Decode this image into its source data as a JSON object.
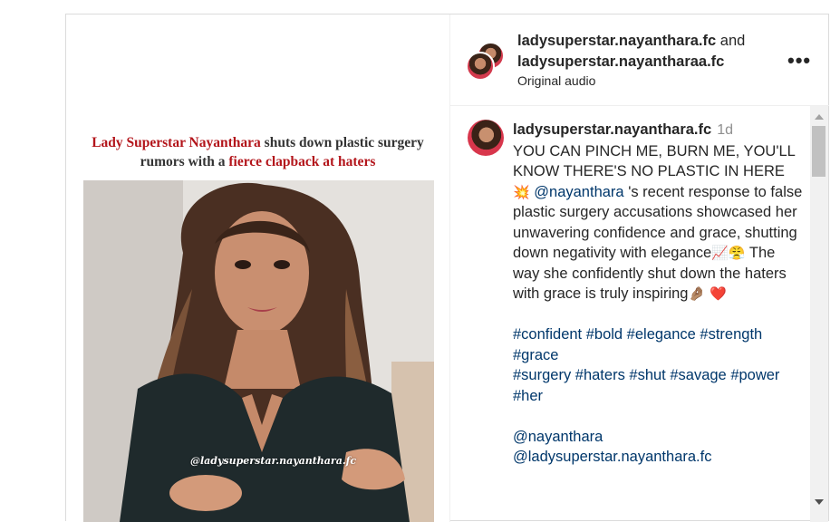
{
  "media": {
    "headline_part1": "Lady Superstar Nayanthara",
    "headline_part2": " shuts down plastic surgery",
    "headline_part3": "rumors with a ",
    "headline_part4": "fierce clapback at haters",
    "watermark": "@ladysuperstar.nayanthara.fc"
  },
  "header": {
    "user1": "ladysuperstar.nayanthara.fc",
    "and": " and",
    "user2": "ladysuperstar.nayantharaa.fc",
    "audio": "Original audio",
    "more": "•••"
  },
  "comment": {
    "username": "ladysuperstar.nayanthara.fc",
    "time": "1d",
    "line1": "YOU CAN PINCH ME, BURN ME, YOU'LL KNOW THERE'S NO PLASTIC IN HERE",
    "emoji1": "💥",
    "mention1": "@nayanthara",
    "text2": " 's recent response to false plastic surgery accusations showcased her unwavering confidence and grace, shutting down negativity with elegance",
    "emoji2": "📈😤",
    "text3": " The way she confidently shut down the haters with grace is truly inspiring",
    "emoji3": "🤌🏽 ❤️",
    "hashtags_line1": "#confident #bold #elegance #strength #grace",
    "hashtags_line2": "#surgery #haters #shut #savage #power #her",
    "mention2": "@nayanthara",
    "mention3": "@ladysuperstar.nayanthara.fc"
  },
  "colors": {
    "headline_red": "#b3151b",
    "link_blue": "#00376b",
    "muted": "#8e8e8e"
  }
}
